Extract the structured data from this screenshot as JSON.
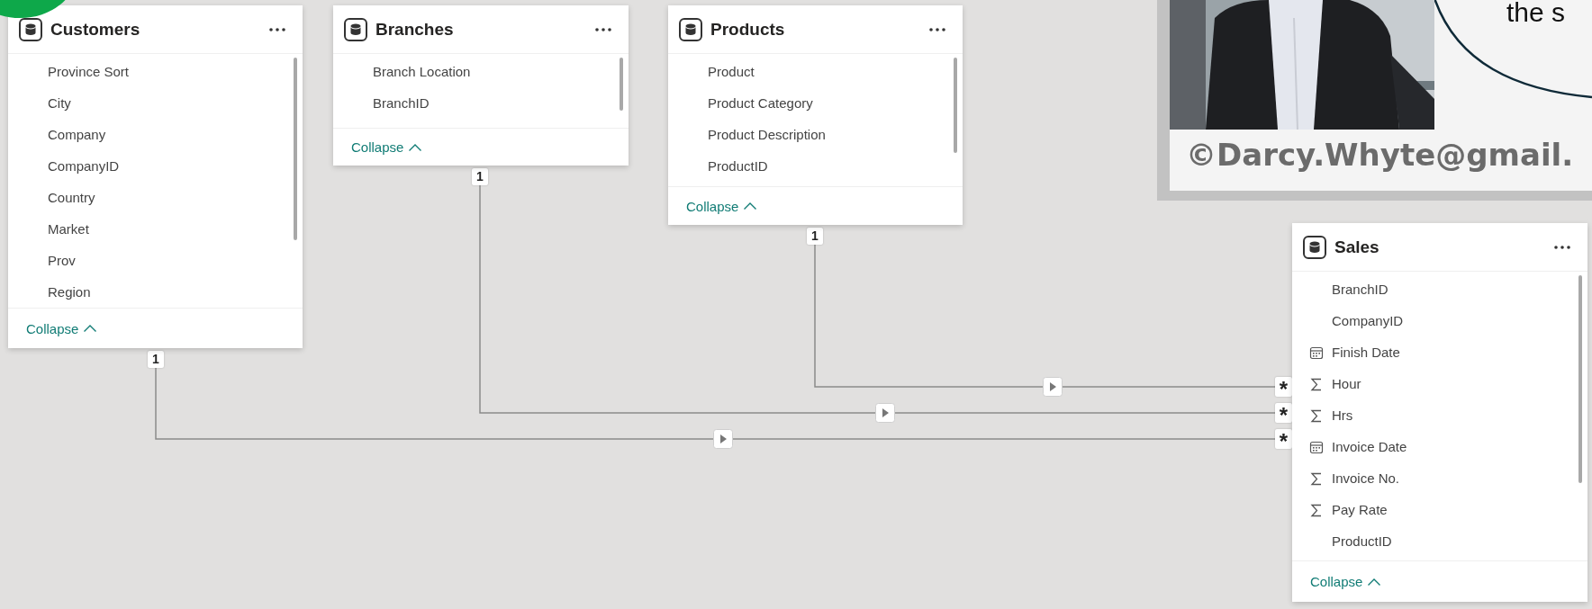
{
  "tables": [
    {
      "title": "Customers",
      "fields": [
        {
          "name": "Province Sort",
          "kind": "text"
        },
        {
          "name": "City",
          "kind": "text"
        },
        {
          "name": "Company",
          "kind": "text"
        },
        {
          "name": "CompanyID",
          "kind": "text"
        },
        {
          "name": "Country",
          "kind": "text"
        },
        {
          "name": "Market",
          "kind": "text"
        },
        {
          "name": "Prov",
          "kind": "text"
        },
        {
          "name": "Region",
          "kind": "text"
        }
      ],
      "collapse": "Collapse"
    },
    {
      "title": "Branches",
      "fields": [
        {
          "name": "Branch Location",
          "kind": "text"
        },
        {
          "name": "BranchID",
          "kind": "text"
        }
      ],
      "collapse": "Collapse"
    },
    {
      "title": "Products",
      "fields": [
        {
          "name": "Product",
          "kind": "text"
        },
        {
          "name": "Product Category",
          "kind": "text"
        },
        {
          "name": "Product Description",
          "kind": "text"
        },
        {
          "name": "ProductID",
          "kind": "text"
        }
      ],
      "collapse": "Collapse"
    },
    {
      "title": "Sales",
      "fields": [
        {
          "name": "BranchID",
          "kind": "text"
        },
        {
          "name": "CompanyID",
          "kind": "text"
        },
        {
          "name": "Finish Date",
          "kind": "date"
        },
        {
          "name": "Hour",
          "kind": "number"
        },
        {
          "name": "Hrs",
          "kind": "number"
        },
        {
          "name": "Invoice Date",
          "kind": "date"
        },
        {
          "name": "Invoice No.",
          "kind": "number"
        },
        {
          "name": "Pay Rate",
          "kind": "number"
        },
        {
          "name": "ProductID",
          "kind": "text"
        }
      ],
      "collapse": "Collapse"
    }
  ],
  "relationships": [
    {
      "one": "1",
      "many": "*"
    },
    {
      "one": "1",
      "many": "*"
    },
    {
      "one": "1",
      "many": "*"
    }
  ],
  "overlay": {
    "bubble_text": "the s",
    "caption": "©Darcy.Whyte@gmail."
  }
}
